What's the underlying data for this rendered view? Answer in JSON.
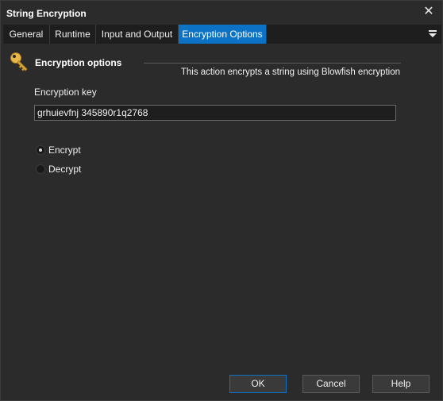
{
  "window": {
    "title": "String Encryption",
    "close_glyph": "✕"
  },
  "tabs": [
    {
      "label": "General",
      "active": false
    },
    {
      "label": "Runtime",
      "active": false
    },
    {
      "label": "Input and Output",
      "active": false
    },
    {
      "label": "Encryption Options",
      "active": true
    }
  ],
  "tab_menu_icon": "dropdown-menu-icon",
  "section": {
    "icon": "key-icon",
    "title": "Encryption options",
    "description": "This action encrypts a string using Blowfish encryption"
  },
  "encryption_key": {
    "label": "Encryption key",
    "value": "grhuievfnj 345890r1q2768"
  },
  "mode": {
    "options": [
      {
        "label": "Encrypt",
        "selected": true
      },
      {
        "label": "Decrypt",
        "selected": false
      }
    ]
  },
  "buttons": {
    "ok": "OK",
    "cancel": "Cancel",
    "help": "Help"
  },
  "colors": {
    "background": "#2b2b2b",
    "accent": "#0b72c5",
    "tabbar": "#1e1e1e"
  }
}
